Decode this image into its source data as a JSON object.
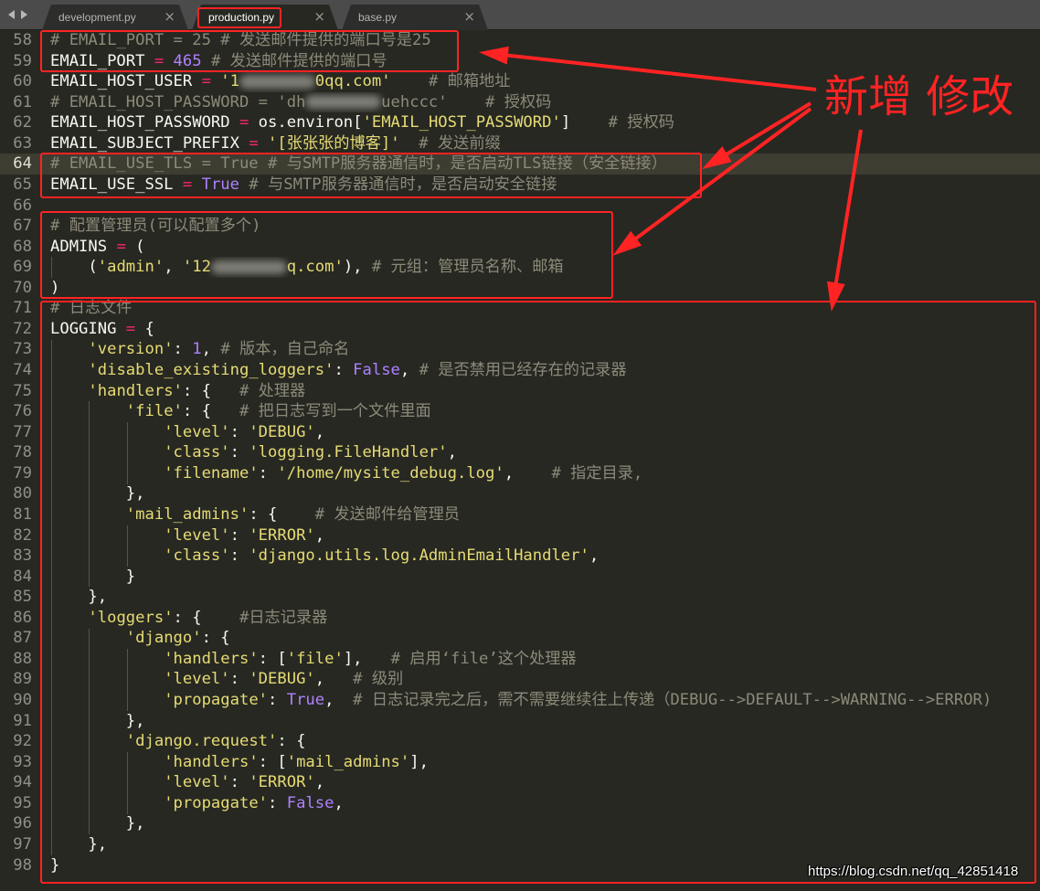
{
  "icons": {
    "nav_back": "triangle-left-icon",
    "nav_forward": "triangle-right-icon",
    "tab_close": "close-icon"
  },
  "tabs": [
    {
      "label": "development.py",
      "close": "×",
      "active": false
    },
    {
      "label": "production.py",
      "close": "×",
      "active": true
    },
    {
      "label": "base.py",
      "close": "×",
      "active": false
    }
  ],
  "colors": {
    "editor_bg": "#272822",
    "current_line_bg": "#3e3d32",
    "gutter_fg": "#90908a",
    "annotation_red": "#ff2323",
    "tabbar_bg": "#4b4b4b",
    "tab_bg": "#2d2d2b",
    "tab_text": "#b4b4b4",
    "syntax": {
      "plain": "#f8f8f2",
      "op": "#f92672",
      "str": "#e6db74",
      "num": "#ae81ff",
      "cm": "#8c8a79"
    }
  },
  "editor": {
    "current_line": 64,
    "lines": [
      {
        "n": 58,
        "tokens": [
          {
            "cm": "# EMAIL_PORT = 25 # 发送邮件提供的端口号是25"
          }
        ]
      },
      {
        "n": 59,
        "tokens": [
          {
            "plain": "EMAIL_PORT "
          },
          {
            "op": "="
          },
          {
            "plain": " "
          },
          {
            "num": "465"
          },
          {
            "cm": " # 发送邮件提供的端口号"
          }
        ]
      },
      {
        "n": 60,
        "tokens": [
          {
            "plain": "EMAIL_HOST_USER "
          },
          {
            "op": "="
          },
          {
            "plain": " "
          },
          {
            "str": "'1"
          },
          {
            "redacted": true
          },
          {
            "str": "0qq.com'"
          },
          {
            "cm": "    # 邮箱地址"
          }
        ]
      },
      {
        "n": 61,
        "tokens": [
          {
            "cm": "# EMAIL_HOST_PASSWORD = 'dh"
          },
          {
            "redacted": true
          },
          {
            "cm": "uehccc'    # 授权码"
          }
        ]
      },
      {
        "n": 62,
        "tokens": [
          {
            "plain": "EMAIL_HOST_PASSWORD "
          },
          {
            "op": "="
          },
          {
            "plain": " os.environ["
          },
          {
            "str": "'EMAIL_HOST_PASSWORD'"
          },
          {
            "plain": "]"
          },
          {
            "cm": "    # 授权码"
          }
        ]
      },
      {
        "n": 63,
        "tokens": [
          {
            "plain": "EMAIL_SUBJECT_PREFIX "
          },
          {
            "op": "="
          },
          {
            "plain": " "
          },
          {
            "str": "'[张张张的博客]'"
          },
          {
            "cm": "  # 发送前缀"
          }
        ]
      },
      {
        "n": 64,
        "tokens": [
          {
            "cm": "# EMAIL_USE_TLS = True # 与SMTP服务器通信时，是否启动TLS链接（安全链接）"
          }
        ]
      },
      {
        "n": 65,
        "tokens": [
          {
            "plain": "EMAIL_USE_SSL "
          },
          {
            "op": "="
          },
          {
            "plain": " "
          },
          {
            "num": "True"
          },
          {
            "cm": " # 与SMTP服务器通信时，是否启动安全链接"
          }
        ]
      },
      {
        "n": 66,
        "tokens": []
      },
      {
        "n": 67,
        "tokens": [
          {
            "cm": "# 配置管理员(可以配置多个)"
          }
        ]
      },
      {
        "n": 68,
        "tokens": [
          {
            "plain": "ADMINS "
          },
          {
            "op": "="
          },
          {
            "plain": " ("
          }
        ]
      },
      {
        "n": 69,
        "tokens": [
          {
            "plain": "    ("
          },
          {
            "str": "'admin'"
          },
          {
            "plain": ", "
          },
          {
            "str": "'12"
          },
          {
            "redacted": true
          },
          {
            "str": "q.com'"
          },
          {
            "plain": "), "
          },
          {
            "cm": "# 元组：管理员名称、邮箱"
          }
        ]
      },
      {
        "n": 70,
        "tokens": [
          {
            "plain": ")"
          }
        ]
      },
      {
        "n": 71,
        "tokens": [
          {
            "cm": "# 日志文件"
          }
        ]
      },
      {
        "n": 72,
        "tokens": [
          {
            "plain": "LOGGING "
          },
          {
            "op": "="
          },
          {
            "plain": " {"
          }
        ]
      },
      {
        "n": 73,
        "tokens": [
          {
            "plain": "    "
          },
          {
            "str": "'version'"
          },
          {
            "plain": ": "
          },
          {
            "num": "1"
          },
          {
            "plain": ", "
          },
          {
            "cm": "# 版本，自己命名"
          }
        ]
      },
      {
        "n": 74,
        "tokens": [
          {
            "plain": "    "
          },
          {
            "str": "'disable_existing_loggers'"
          },
          {
            "plain": ": "
          },
          {
            "num": "False"
          },
          {
            "plain": ", "
          },
          {
            "cm": "# 是否禁用已经存在的记录器"
          }
        ]
      },
      {
        "n": 75,
        "tokens": [
          {
            "plain": "    "
          },
          {
            "str": "'handlers'"
          },
          {
            "plain": ": {   "
          },
          {
            "cm": "# 处理器"
          }
        ]
      },
      {
        "n": 76,
        "tokens": [
          {
            "plain": "        "
          },
          {
            "str": "'file'"
          },
          {
            "plain": ": {   "
          },
          {
            "cm": "# 把日志写到一个文件里面"
          }
        ]
      },
      {
        "n": 77,
        "tokens": [
          {
            "plain": "            "
          },
          {
            "str": "'level'"
          },
          {
            "plain": ": "
          },
          {
            "str": "'DEBUG'"
          },
          {
            "plain": ","
          }
        ]
      },
      {
        "n": 78,
        "tokens": [
          {
            "plain": "            "
          },
          {
            "str": "'class'"
          },
          {
            "plain": ": "
          },
          {
            "str": "'logging.FileHandler'"
          },
          {
            "plain": ","
          }
        ]
      },
      {
        "n": 79,
        "tokens": [
          {
            "plain": "            "
          },
          {
            "str": "'filename'"
          },
          {
            "plain": ": "
          },
          {
            "str": "'/home/mysite_debug.log'"
          },
          {
            "plain": ",    "
          },
          {
            "cm": "# 指定目录,"
          }
        ]
      },
      {
        "n": 80,
        "tokens": [
          {
            "plain": "        },"
          }
        ]
      },
      {
        "n": 81,
        "tokens": [
          {
            "plain": "        "
          },
          {
            "str": "'mail_admins'"
          },
          {
            "plain": ": {    "
          },
          {
            "cm": "# 发送邮件给管理员"
          }
        ]
      },
      {
        "n": 82,
        "tokens": [
          {
            "plain": "            "
          },
          {
            "str": "'level'"
          },
          {
            "plain": ": "
          },
          {
            "str": "'ERROR'"
          },
          {
            "plain": ","
          }
        ]
      },
      {
        "n": 83,
        "tokens": [
          {
            "plain": "            "
          },
          {
            "str": "'class'"
          },
          {
            "plain": ": "
          },
          {
            "str": "'django.utils.log.AdminEmailHandler'"
          },
          {
            "plain": ","
          }
        ]
      },
      {
        "n": 84,
        "tokens": [
          {
            "plain": "        }"
          }
        ]
      },
      {
        "n": 85,
        "tokens": [
          {
            "plain": "    },"
          }
        ]
      },
      {
        "n": 86,
        "tokens": [
          {
            "plain": "    "
          },
          {
            "str": "'loggers'"
          },
          {
            "plain": ": {    "
          },
          {
            "cm": "#日志记录器"
          }
        ]
      },
      {
        "n": 87,
        "tokens": [
          {
            "plain": "        "
          },
          {
            "str": "'django'"
          },
          {
            "plain": ": {"
          }
        ]
      },
      {
        "n": 88,
        "tokens": [
          {
            "plain": "            "
          },
          {
            "str": "'handlers'"
          },
          {
            "plain": ": ["
          },
          {
            "str": "'file'"
          },
          {
            "plain": "],   "
          },
          {
            "cm": "# 启用‘file’这个处理器"
          }
        ]
      },
      {
        "n": 89,
        "tokens": [
          {
            "plain": "            "
          },
          {
            "str": "'level'"
          },
          {
            "plain": ": "
          },
          {
            "str": "'DEBUG'"
          },
          {
            "plain": ",   "
          },
          {
            "cm": "# 级别"
          }
        ]
      },
      {
        "n": 90,
        "tokens": [
          {
            "plain": "            "
          },
          {
            "str": "'propagate'"
          },
          {
            "plain": ": "
          },
          {
            "num": "True"
          },
          {
            "plain": ",  "
          },
          {
            "cm": "# 日志记录完之后，需不需要继续往上传递（DEBUG-->DEFAULT-->WARNING-->ERROR)"
          }
        ]
      },
      {
        "n": 91,
        "tokens": [
          {
            "plain": "        },"
          }
        ]
      },
      {
        "n": 92,
        "tokens": [
          {
            "plain": "        "
          },
          {
            "str": "'django.request'"
          },
          {
            "plain": ": {"
          }
        ]
      },
      {
        "n": 93,
        "tokens": [
          {
            "plain": "            "
          },
          {
            "str": "'handlers'"
          },
          {
            "plain": ": ["
          },
          {
            "str": "'mail_admins'"
          },
          {
            "plain": "],"
          }
        ]
      },
      {
        "n": 94,
        "tokens": [
          {
            "plain": "            "
          },
          {
            "str": "'level'"
          },
          {
            "plain": ": "
          },
          {
            "str": "'ERROR'"
          },
          {
            "plain": ","
          }
        ]
      },
      {
        "n": 95,
        "tokens": [
          {
            "plain": "            "
          },
          {
            "str": "'propagate'"
          },
          {
            "plain": ": "
          },
          {
            "num": "False"
          },
          {
            "plain": ","
          }
        ]
      },
      {
        "n": 96,
        "tokens": [
          {
            "plain": "        },"
          }
        ]
      },
      {
        "n": 97,
        "tokens": [
          {
            "plain": "    },"
          }
        ]
      },
      {
        "n": 98,
        "tokens": [
          {
            "plain": "}"
          }
        ]
      }
    ]
  },
  "annotation": {
    "label": "新增 修改"
  },
  "watermark": "https://blog.csdn.net/qq_42851418"
}
